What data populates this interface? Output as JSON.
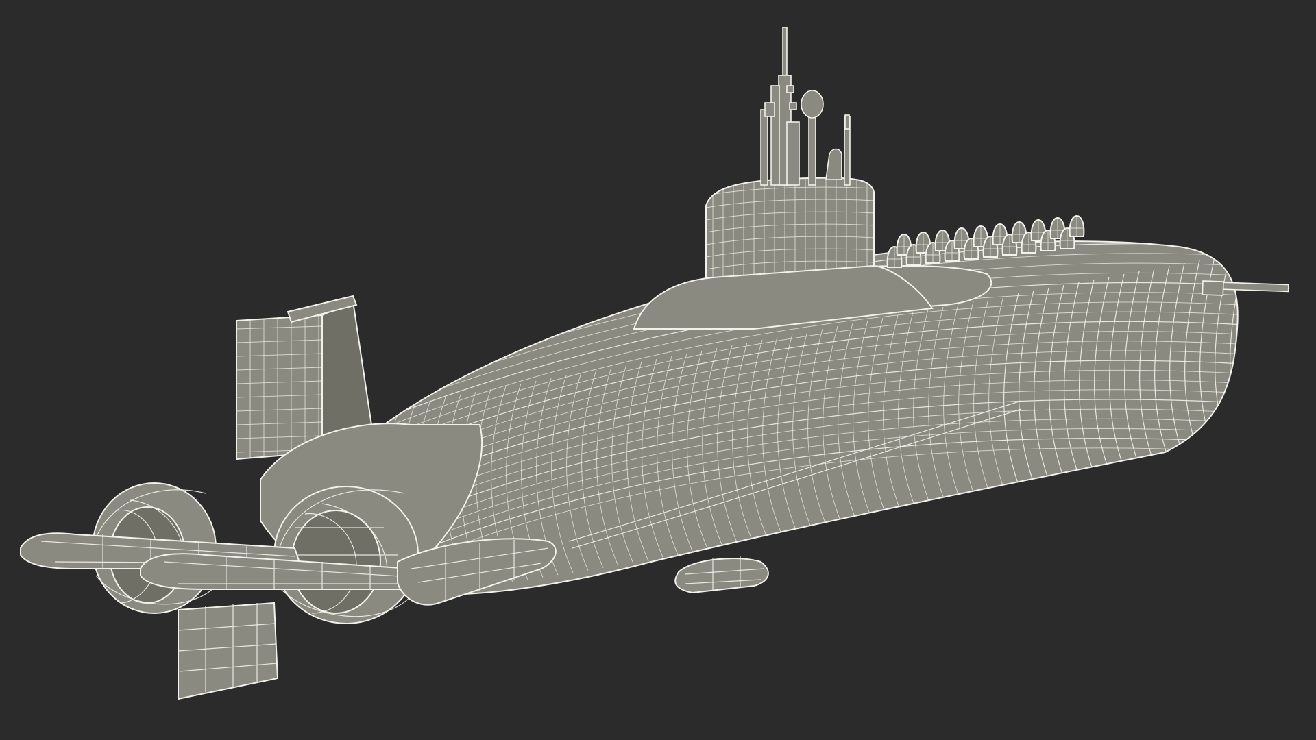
{
  "scene": {
    "background_color": "#2b2b2b",
    "model_fill_color": "#8a8a80",
    "wireframe_color": "#f2f2ea",
    "render_style": "wireframe-over-shaded"
  },
  "model": {
    "subject": "submarine",
    "parts": [
      "hull",
      "sail",
      "periscope-masts",
      "missile-hatches",
      "rudder",
      "stern-planes",
      "propeller-shrouds",
      "bow-probe"
    ],
    "missile_hatch_count": 20,
    "propeller_count": 2
  }
}
